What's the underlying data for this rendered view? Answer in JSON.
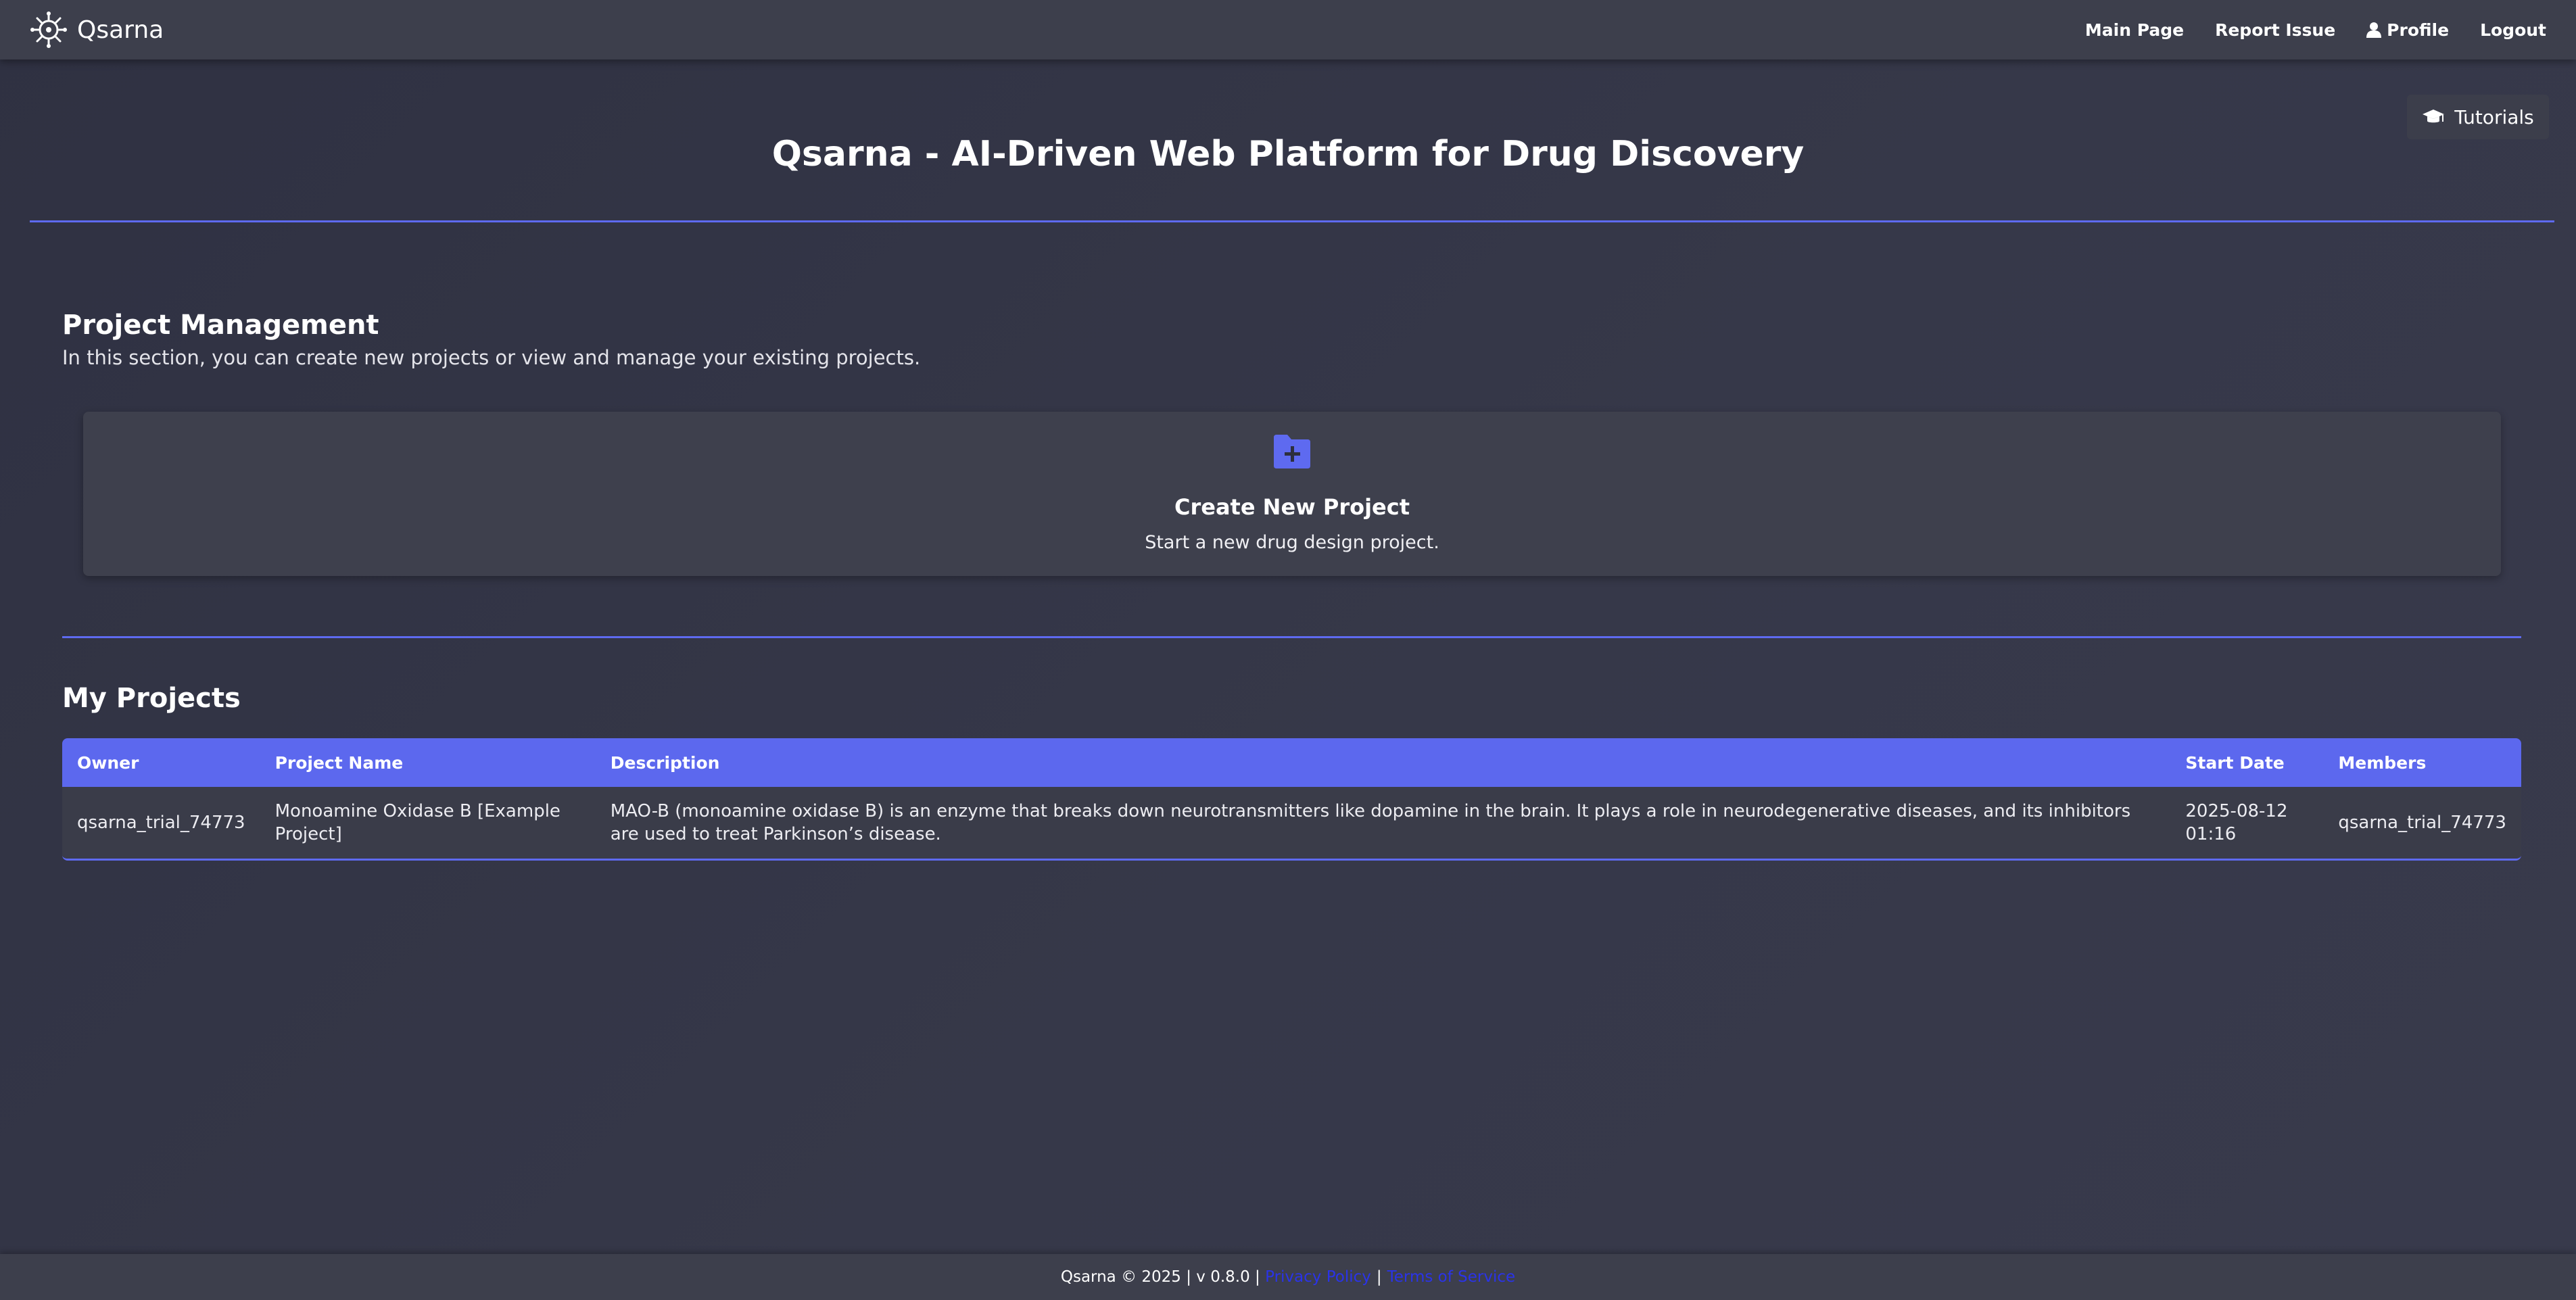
{
  "navbar": {
    "brand": "Qsarna",
    "links": {
      "main_page": "Main Page",
      "report_issue": "Report Issue",
      "profile": "Profile",
      "logout": "Logout"
    }
  },
  "tutorials": {
    "label": "Tutorials"
  },
  "page_title": "Qsarna - AI-Driven Web Platform for Drug Discovery",
  "project_management": {
    "title": "Project Management",
    "description": "In this section, you can create new projects or view and manage your existing projects.",
    "create_card": {
      "title": "Create New Project",
      "subtitle": "Start a new drug design project."
    }
  },
  "my_projects": {
    "title": "My Projects",
    "columns": [
      "Owner",
      "Project Name",
      "Description",
      "Start Date",
      "Members"
    ],
    "rows": [
      {
        "owner": "qsarna_trial_74773",
        "name": "Monoamine Oxidase B [Example Project]",
        "description": "MAO-B (monoamine oxidase B) is an enzyme that breaks down neurotransmitters like dopamine in the brain. It plays a role in neurodegenerative diseases, and its inhibitors are used to treat Parkinson’s disease.",
        "start_date": "2025-08-12 01:16",
        "members": "qsarna_trial_74773"
      }
    ]
  },
  "footer": {
    "copyright": "Qsarna © 2025 | v 0.8.0 |",
    "separator": "|",
    "privacy_policy": "Privacy Policy",
    "terms_of_service": "Terms of Service"
  },
  "colors": {
    "accent": "#5e6af0",
    "navbar_bg": "#3d3f4c",
    "card_bg": "#3e404d",
    "link": "#2a33e8"
  },
  "icons": [
    "logo-icon",
    "user-icon",
    "graduation-cap-icon",
    "folder-plus-icon"
  ]
}
